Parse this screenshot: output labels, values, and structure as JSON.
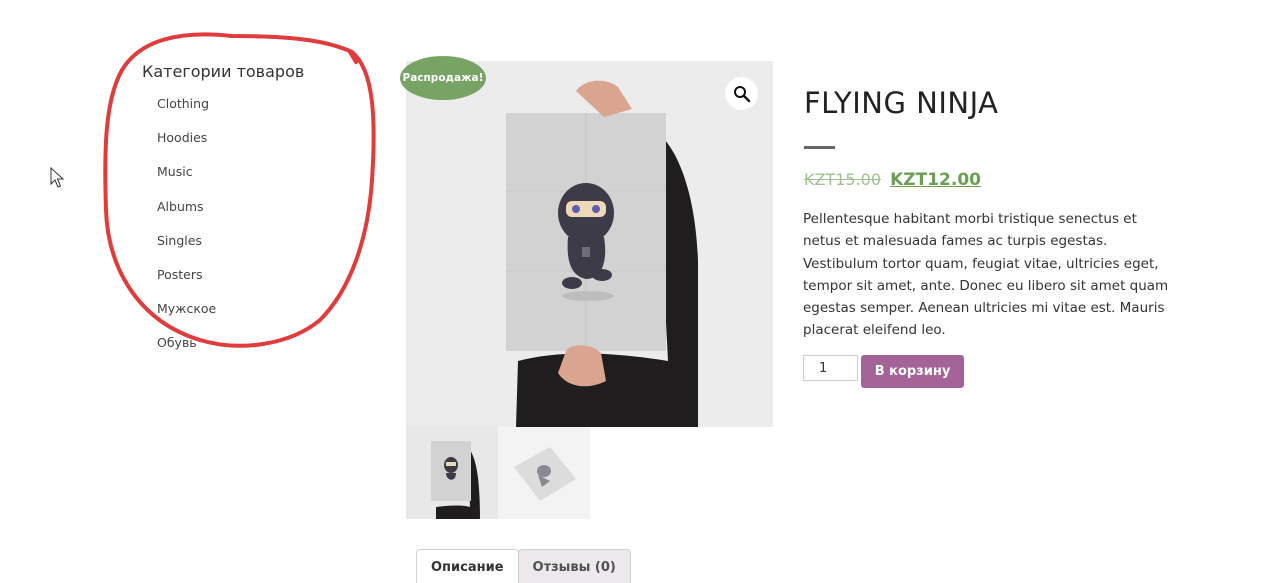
{
  "sidebar": {
    "title": "Категории товаров",
    "categories": [
      {
        "label": "Clothing"
      },
      {
        "label": "Hoodies"
      },
      {
        "label": "Music"
      },
      {
        "label": "Albums"
      },
      {
        "label": "Singles"
      },
      {
        "label": "Posters"
      },
      {
        "label": "Мужское"
      },
      {
        "label": "Обувь"
      }
    ]
  },
  "gallery": {
    "sale_badge": "Распродажа!",
    "zoom_icon": "magnifier-icon",
    "thumbnail_count": 2
  },
  "product": {
    "title": "FLYING NINJA",
    "price_old": "KZT15.00",
    "price_new": "KZT12.00",
    "description": "Pellentesque habitant morbi tristique senectus et netus et malesuada fames ac turpis egestas. Vestibulum tortor quam, feugiat vitae, ultricies eget, tempor sit amet, ante. Donec eu libero sit amet quam egestas semper. Aenean ultricies mi vitae est. Mauris placerat eleifend leo.",
    "quantity": "1",
    "add_to_cart_label": "В корзину"
  },
  "tabs": [
    {
      "label": "Описание",
      "active": true
    },
    {
      "label": "Отзывы (0)",
      "active": false
    }
  ],
  "colors": {
    "sale_badge": "#77a464",
    "price": "#6a9f54",
    "button": "#a46497",
    "annotation": "#e03c3c"
  }
}
